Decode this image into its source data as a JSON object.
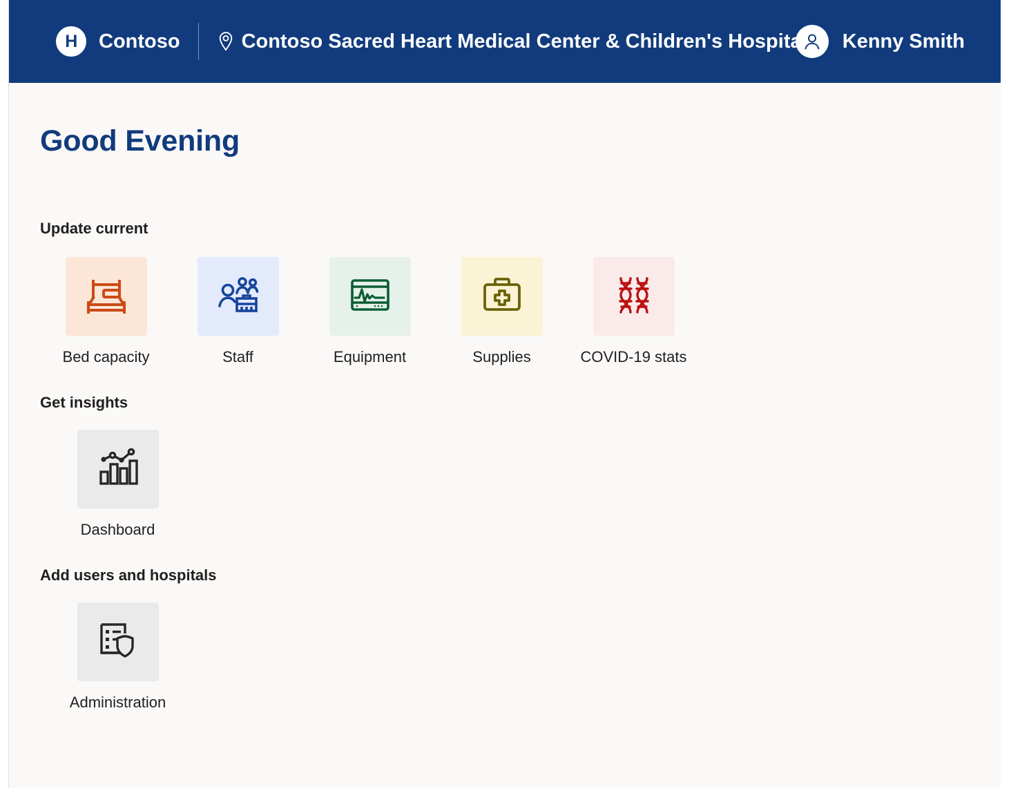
{
  "header": {
    "brand_logo_letter": "H",
    "brand_name": "Contoso",
    "facility_name": "Contoso Sacred Heart Medical Center & Children's Hospital",
    "user_name": "Kenny Smith",
    "bar_color": "#123b7d"
  },
  "page": {
    "greeting": "Good Evening",
    "greeting_color": "#123b7d",
    "background": "#faf9f8"
  },
  "sections": [
    {
      "title": "Update current",
      "tiles": [
        {
          "label": "Bed capacity",
          "icon": "bed-icon",
          "bg": "#fce6d8",
          "fg": "#cc4a16"
        },
        {
          "label": "Staff",
          "icon": "staff-icon",
          "bg": "#e3eafc",
          "fg": "#16449c"
        },
        {
          "label": "Equipment",
          "icon": "monitor-icon",
          "bg": "#e7f1ec",
          "fg": "#0b5d33"
        },
        {
          "label": "Supplies",
          "icon": "medkit-icon",
          "bg": "#fbf3d5",
          "fg": "#6b6206"
        },
        {
          "label": "COVID-19 stats",
          "icon": "dna-icon",
          "bg": "#fbeaea",
          "fg": "#bb1111"
        }
      ]
    },
    {
      "title": "Get insights",
      "tiles": [
        {
          "label": "Dashboard",
          "icon": "bar-chart-line-icon",
          "bg": "#ebeaea",
          "fg": "#262626"
        }
      ]
    },
    {
      "title": "Add users and hospitals",
      "tiles": [
        {
          "label": "Administration",
          "icon": "list-shield-icon",
          "bg": "#ebeaea",
          "fg": "#262626"
        }
      ]
    }
  ]
}
